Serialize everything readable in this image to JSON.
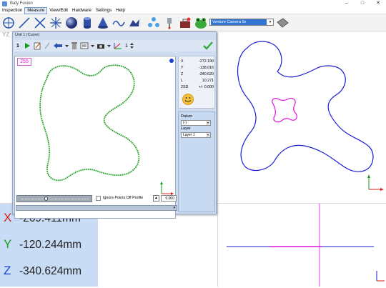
{
  "app": {
    "title": "Baty Fusion"
  },
  "window_controls": {
    "minimize": "–",
    "maximize": "□",
    "close": "✕"
  },
  "menu": [
    "Inspection",
    "Measure",
    "View/Edit",
    "Hardware",
    "Settings",
    "Help"
  ],
  "toolbar": {
    "icons": [
      "circle-crosshair-icon",
      "line-icon",
      "cross-line-icon",
      "point-star-icon",
      "sphere-icon",
      "cylinder-icon",
      "cone-icon",
      "curve-icon",
      "freeform-icon",
      "cluster-icon",
      "probe-icon",
      "toolbox-icon",
      "frog-icon"
    ],
    "camera_select": "Venture Camera 6x",
    "camera_arrow": "▾"
  },
  "view_label": "YZ",
  "dro": {
    "x_axis": "X",
    "x_value": "-269.411mm",
    "y_axis": "Y",
    "y_value": "-120.244mm",
    "z_axis": "Z",
    "z_value": "-340.624mm"
  },
  "unit_window": {
    "title": "Unit 1 (Curve)",
    "toolbar_number": "1",
    "probe_count_label": "1",
    "point_count": "255",
    "readout": {
      "x_label": "X",
      "x_value": "-272.190",
      "y_label": "Y",
      "y_value": "-138.016",
      "z_label": "Z",
      "z_value": "-340.620",
      "l_label": "L",
      "l_value": "10.271",
      "d_label": "2SD",
      "d_value": "+/- 0.000"
    },
    "datum_label": "Datum",
    "datum_value": "(-)",
    "layer_label": "Layer",
    "layer_value": "Layer 1",
    "ignore_label": "Ignore Points Off Profile",
    "numeric_value": "0.000"
  },
  "colors": {
    "curve_blue": "#1a1ad6",
    "curve_magenta": "#e010e0",
    "points_green": "#2ea82e",
    "axis_red": "#d81c1c",
    "axis_green": "#1a9a1a",
    "dro_bg": "#c9dcf6"
  }
}
